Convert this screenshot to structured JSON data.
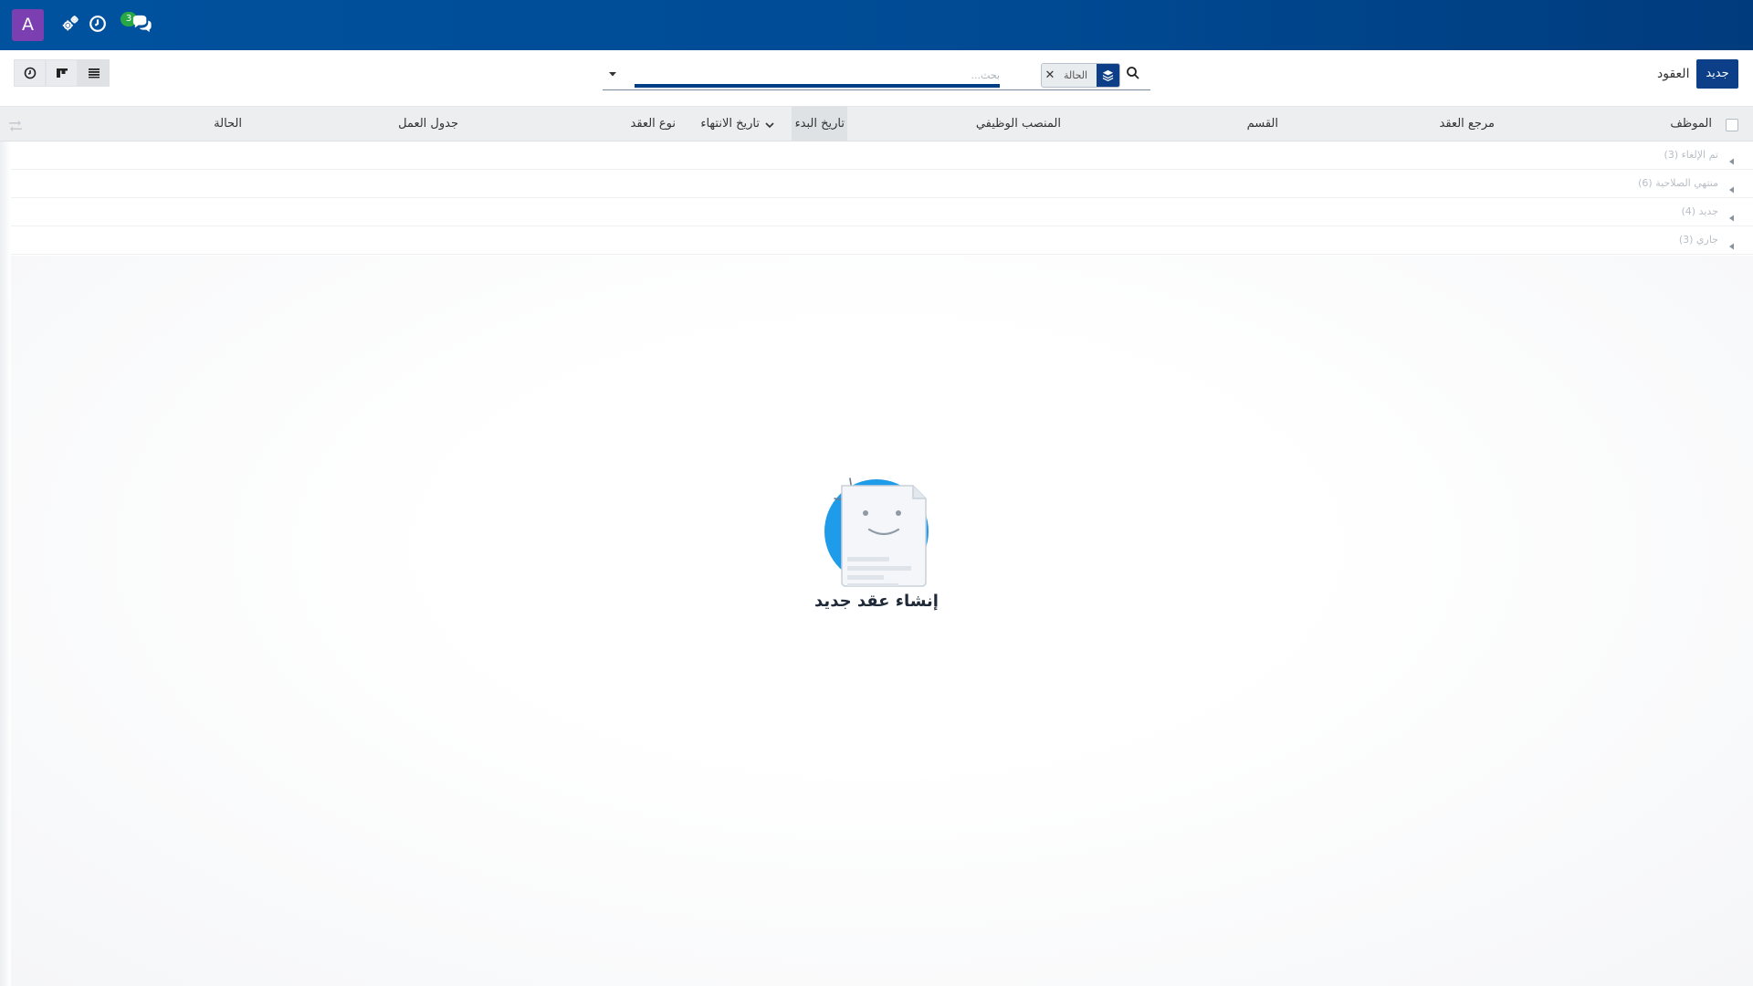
{
  "navbar": {
    "avatar_letter": "A",
    "chat_badge": "3",
    "icons": [
      "gears-icon",
      "clock-icon",
      "chat-icon"
    ]
  },
  "control_panel": {
    "title": "العقود",
    "new_button": "جديد",
    "search": {
      "placeholder": "بحث...",
      "facet_value": "الحالة"
    },
    "views": [
      "activity-view",
      "kanban-view",
      "list-view"
    ]
  },
  "list": {
    "columns": [
      "الموظف",
      "مرجع العقد",
      "القسم",
      "المنصب الوظيفي",
      "تاريخ البدء",
      "تاريخ الانتهاء",
      "نوع العقد",
      "جدول العمل",
      "الحالة"
    ],
    "sorted_column": "تاريخ البدء",
    "groups": [
      {
        "label": "تم الإلغاء (3)"
      },
      {
        "label": "منتهي الصلاحية (6)"
      },
      {
        "label": "جديد (4)"
      },
      {
        "label": "جاري (3)"
      }
    ]
  },
  "empty_state": {
    "title": "إنشاء عقد جديد"
  },
  "colors": {
    "navbar": "#00529f",
    "primary": "#0c3f87",
    "avatar": "#7c3fb1",
    "badge": "#28a745"
  }
}
